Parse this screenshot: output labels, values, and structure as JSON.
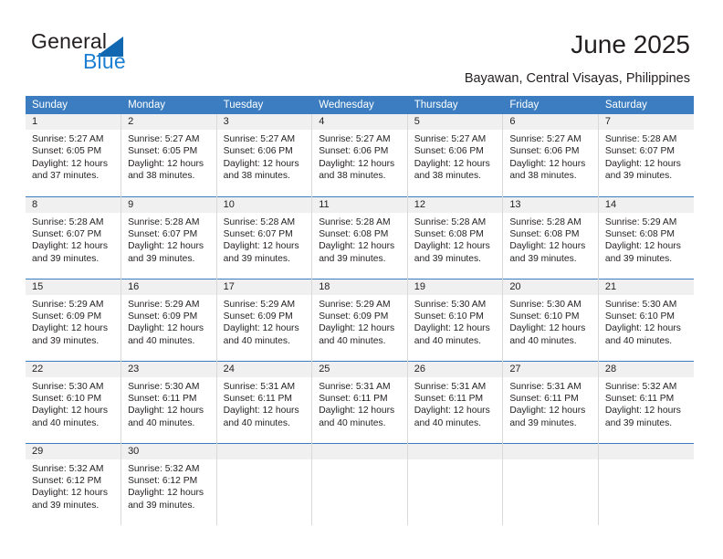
{
  "brand": {
    "name_part1": "General",
    "name_part2": "Blue",
    "color_text": "#231f20",
    "color_accent": "#1b7fd4",
    "triangle_icon": "triangle-icon"
  },
  "header": {
    "title": "June 2025",
    "subtitle": "Bayawan, Central Visayas, Philippines"
  },
  "calendar": {
    "header_bg": "#3b7dc0",
    "daynum_bg": "#f0f0f0",
    "weekday_headers": [
      "Sunday",
      "Monday",
      "Tuesday",
      "Wednesday",
      "Thursday",
      "Friday",
      "Saturday"
    ],
    "weeks": [
      [
        {
          "day": "1",
          "sunrise": "Sunrise: 5:27 AM",
          "sunset": "Sunset: 6:05 PM",
          "daylight_line1": "Daylight: 12 hours",
          "daylight_line2": "and 37 minutes."
        },
        {
          "day": "2",
          "sunrise": "Sunrise: 5:27 AM",
          "sunset": "Sunset: 6:05 PM",
          "daylight_line1": "Daylight: 12 hours",
          "daylight_line2": "and 38 minutes."
        },
        {
          "day": "3",
          "sunrise": "Sunrise: 5:27 AM",
          "sunset": "Sunset: 6:06 PM",
          "daylight_line1": "Daylight: 12 hours",
          "daylight_line2": "and 38 minutes."
        },
        {
          "day": "4",
          "sunrise": "Sunrise: 5:27 AM",
          "sunset": "Sunset: 6:06 PM",
          "daylight_line1": "Daylight: 12 hours",
          "daylight_line2": "and 38 minutes."
        },
        {
          "day": "5",
          "sunrise": "Sunrise: 5:27 AM",
          "sunset": "Sunset: 6:06 PM",
          "daylight_line1": "Daylight: 12 hours",
          "daylight_line2": "and 38 minutes."
        },
        {
          "day": "6",
          "sunrise": "Sunrise: 5:27 AM",
          "sunset": "Sunset: 6:06 PM",
          "daylight_line1": "Daylight: 12 hours",
          "daylight_line2": "and 38 minutes."
        },
        {
          "day": "7",
          "sunrise": "Sunrise: 5:28 AM",
          "sunset": "Sunset: 6:07 PM",
          "daylight_line1": "Daylight: 12 hours",
          "daylight_line2": "and 39 minutes."
        }
      ],
      [
        {
          "day": "8",
          "sunrise": "Sunrise: 5:28 AM",
          "sunset": "Sunset: 6:07 PM",
          "daylight_line1": "Daylight: 12 hours",
          "daylight_line2": "and 39 minutes."
        },
        {
          "day": "9",
          "sunrise": "Sunrise: 5:28 AM",
          "sunset": "Sunset: 6:07 PM",
          "daylight_line1": "Daylight: 12 hours",
          "daylight_line2": "and 39 minutes."
        },
        {
          "day": "10",
          "sunrise": "Sunrise: 5:28 AM",
          "sunset": "Sunset: 6:07 PM",
          "daylight_line1": "Daylight: 12 hours",
          "daylight_line2": "and 39 minutes."
        },
        {
          "day": "11",
          "sunrise": "Sunrise: 5:28 AM",
          "sunset": "Sunset: 6:08 PM",
          "daylight_line1": "Daylight: 12 hours",
          "daylight_line2": "and 39 minutes."
        },
        {
          "day": "12",
          "sunrise": "Sunrise: 5:28 AM",
          "sunset": "Sunset: 6:08 PM",
          "daylight_line1": "Daylight: 12 hours",
          "daylight_line2": "and 39 minutes."
        },
        {
          "day": "13",
          "sunrise": "Sunrise: 5:28 AM",
          "sunset": "Sunset: 6:08 PM",
          "daylight_line1": "Daylight: 12 hours",
          "daylight_line2": "and 39 minutes."
        },
        {
          "day": "14",
          "sunrise": "Sunrise: 5:29 AM",
          "sunset": "Sunset: 6:08 PM",
          "daylight_line1": "Daylight: 12 hours",
          "daylight_line2": "and 39 minutes."
        }
      ],
      [
        {
          "day": "15",
          "sunrise": "Sunrise: 5:29 AM",
          "sunset": "Sunset: 6:09 PM",
          "daylight_line1": "Daylight: 12 hours",
          "daylight_line2": "and 39 minutes."
        },
        {
          "day": "16",
          "sunrise": "Sunrise: 5:29 AM",
          "sunset": "Sunset: 6:09 PM",
          "daylight_line1": "Daylight: 12 hours",
          "daylight_line2": "and 40 minutes."
        },
        {
          "day": "17",
          "sunrise": "Sunrise: 5:29 AM",
          "sunset": "Sunset: 6:09 PM",
          "daylight_line1": "Daylight: 12 hours",
          "daylight_line2": "and 40 minutes."
        },
        {
          "day": "18",
          "sunrise": "Sunrise: 5:29 AM",
          "sunset": "Sunset: 6:09 PM",
          "daylight_line1": "Daylight: 12 hours",
          "daylight_line2": "and 40 minutes."
        },
        {
          "day": "19",
          "sunrise": "Sunrise: 5:30 AM",
          "sunset": "Sunset: 6:10 PM",
          "daylight_line1": "Daylight: 12 hours",
          "daylight_line2": "and 40 minutes."
        },
        {
          "day": "20",
          "sunrise": "Sunrise: 5:30 AM",
          "sunset": "Sunset: 6:10 PM",
          "daylight_line1": "Daylight: 12 hours",
          "daylight_line2": "and 40 minutes."
        },
        {
          "day": "21",
          "sunrise": "Sunrise: 5:30 AM",
          "sunset": "Sunset: 6:10 PM",
          "daylight_line1": "Daylight: 12 hours",
          "daylight_line2": "and 40 minutes."
        }
      ],
      [
        {
          "day": "22",
          "sunrise": "Sunrise: 5:30 AM",
          "sunset": "Sunset: 6:10 PM",
          "daylight_line1": "Daylight: 12 hours",
          "daylight_line2": "and 40 minutes."
        },
        {
          "day": "23",
          "sunrise": "Sunrise: 5:30 AM",
          "sunset": "Sunset: 6:11 PM",
          "daylight_line1": "Daylight: 12 hours",
          "daylight_line2": "and 40 minutes."
        },
        {
          "day": "24",
          "sunrise": "Sunrise: 5:31 AM",
          "sunset": "Sunset: 6:11 PM",
          "daylight_line1": "Daylight: 12 hours",
          "daylight_line2": "and 40 minutes."
        },
        {
          "day": "25",
          "sunrise": "Sunrise: 5:31 AM",
          "sunset": "Sunset: 6:11 PM",
          "daylight_line1": "Daylight: 12 hours",
          "daylight_line2": "and 40 minutes."
        },
        {
          "day": "26",
          "sunrise": "Sunrise: 5:31 AM",
          "sunset": "Sunset: 6:11 PM",
          "daylight_line1": "Daylight: 12 hours",
          "daylight_line2": "and 40 minutes."
        },
        {
          "day": "27",
          "sunrise": "Sunrise: 5:31 AM",
          "sunset": "Sunset: 6:11 PM",
          "daylight_line1": "Daylight: 12 hours",
          "daylight_line2": "and 39 minutes."
        },
        {
          "day": "28",
          "sunrise": "Sunrise: 5:32 AM",
          "sunset": "Sunset: 6:11 PM",
          "daylight_line1": "Daylight: 12 hours",
          "daylight_line2": "and 39 minutes."
        }
      ],
      [
        {
          "day": "29",
          "sunrise": "Sunrise: 5:32 AM",
          "sunset": "Sunset: 6:12 PM",
          "daylight_line1": "Daylight: 12 hours",
          "daylight_line2": "and 39 minutes."
        },
        {
          "day": "30",
          "sunrise": "Sunrise: 5:32 AM",
          "sunset": "Sunset: 6:12 PM",
          "daylight_line1": "Daylight: 12 hours",
          "daylight_line2": "and 39 minutes."
        },
        {
          "day": "",
          "sunrise": "",
          "sunset": "",
          "daylight_line1": "",
          "daylight_line2": ""
        },
        {
          "day": "",
          "sunrise": "",
          "sunset": "",
          "daylight_line1": "",
          "daylight_line2": ""
        },
        {
          "day": "",
          "sunrise": "",
          "sunset": "",
          "daylight_line1": "",
          "daylight_line2": ""
        },
        {
          "day": "",
          "sunrise": "",
          "sunset": "",
          "daylight_line1": "",
          "daylight_line2": ""
        },
        {
          "day": "",
          "sunrise": "",
          "sunset": "",
          "daylight_line1": "",
          "daylight_line2": ""
        }
      ]
    ]
  }
}
